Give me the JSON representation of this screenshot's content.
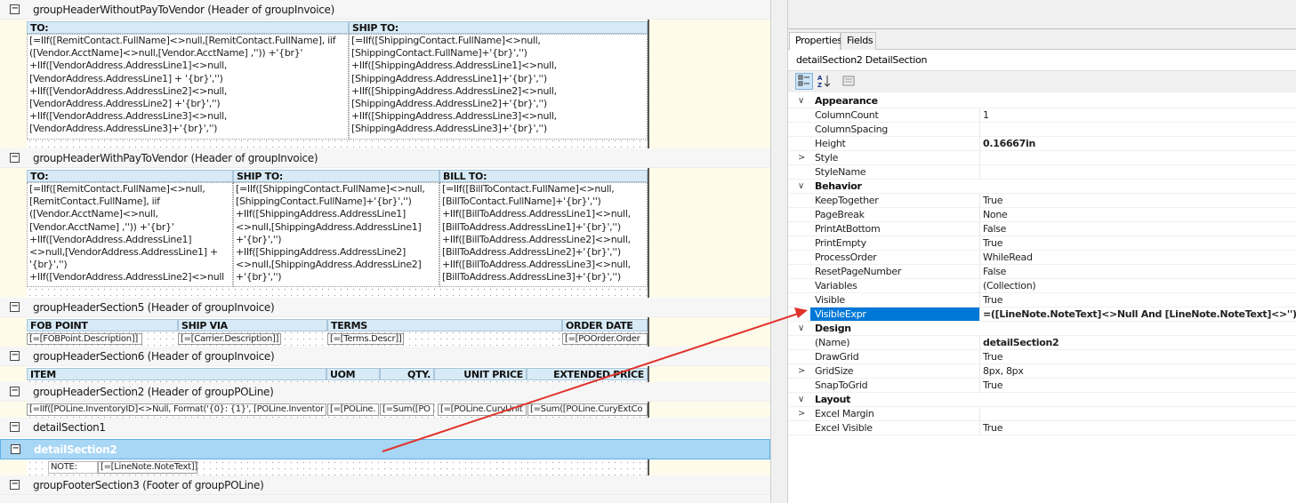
{
  "designer": {
    "bands": [
      {
        "label": "groupHeaderWithoutPayToVendor (Header of groupInvoice)",
        "toggle": "−"
      },
      {
        "label": "groupHeaderWithPayToVendor (Header of groupInvoice)",
        "toggle": "−"
      },
      {
        "label": "groupHeaderSection5 (Header of groupInvoice)",
        "toggle": "−"
      },
      {
        "label": "groupHeaderSection6 (Header of groupInvoice)",
        "toggle": "−"
      },
      {
        "label": "groupHeaderSection2 (Header of groupPOLine)",
        "toggle": "−"
      },
      {
        "label": "detailSection1",
        "toggle": "−"
      },
      {
        "label": "detailSection2",
        "toggle": "−"
      },
      {
        "label": "groupFooterSection3 (Footer of groupPOLine)",
        "toggle": "−"
      }
    ],
    "s1": {
      "to_header": "TO:",
      "shipto_header": "SHIP TO:",
      "to_text": "[=IIf([RemitContact.FullName]<>null,[RemitContact.FullName], iif\n([Vendor.AcctName]<>null,[Vendor.AcctName] ,'')) +'{br}'\n+IIf([VendorAddress.AddressLine1]<>null,\n[VendorAddress.AddressLine1] + '{br}','')\n+IIf([VendorAddress.AddressLine2]<>null,\n[VendorAddress.AddressLine2] +'{br}','')\n+IIf([VendorAddress.AddressLine3]<>null,\n[VendorAddress.AddressLine3]+'{br}','')",
      "shipto_text": "[=IIf([ShippingContact.FullName]<>null,\n[ShippingContact.FullName]+'{br}','')\n+IIf([ShippingAddress.AddressLine1]<>null,\n[ShippingAddress.AddressLine1]+'{br}','')\n+IIf([ShippingAddress.AddressLine2]<>null,\n[ShippingAddress.AddressLine2]+'{br}','')\n+IIf([ShippingAddress.AddressLine3]<>null,\n[ShippingAddress.AddressLine3]+'{br}','')"
    },
    "s2": {
      "to_header": "TO:",
      "shipto_header": "SHIP TO:",
      "billto_header": "BILL TO:",
      "to_text": "[=IIf([RemitContact.FullName]<>null,\n[RemitContact.FullName], iif\n([Vendor.AcctName]<>null,\n[Vendor.AcctName] ,'')) +'{br}'\n+IIf([VendorAddress.AddressLine1]\n<>null,[VendorAddress.AddressLine1] +\n'{br}','')\n+IIf([VendorAddress.AddressLine2]<>null",
      "shipto_text": "[=IIf([ShippingContact.FullName]<>null,\n[ShippingContact.FullName]+'{br}','')\n+IIf([ShippingAddress.AddressLine1]\n<>null,[ShippingAddress.AddressLine1]\n+'{br}','')\n+IIf([ShippingAddress.AddressLine2]\n<>null,[ShippingAddress.AddressLine2]\n+'{br}','')",
      "billto_text": "[=IIf([BillToContact.FullName]<>null,\n[BillToContact.FullName]+'{br}','')\n+IIf([BillToAddress.AddressLine1]<>null,\n[BillToAddress.AddressLine1]+'{br}','')\n+IIf([BillToAddress.AddressLine2]<>null,\n[BillToAddress.AddressLine2]+'{br}','')\n+IIf([BillToAddress.AddressLine3]<>null,\n[BillToAddress.AddressLine3]+'{br}','')"
    },
    "s3": {
      "headers": [
        "FOB POINT",
        "SHIP VIA",
        "TERMS",
        "ORDER DATE"
      ],
      "fields": [
        "[=[FOBPoint.Description]]",
        "[=[Carrier.Description]]",
        "[=[Terms.Descr]]",
        "[=[POOrder.Order"
      ]
    },
    "s4": {
      "headers": [
        "ITEM",
        "UOM",
        "QTY.",
        "UNIT PRICE",
        "EXTENDED PRICE"
      ]
    },
    "s5": {
      "fields": [
        "[=IIf([POLine.InventoryID]<>Null, Format('{0}: {1}', [POLine.Inventor",
        "[=[POLine.",
        "[=Sum([PO",
        "[=[POLine.CuryUnit",
        "[=Sum([POLine.CuryExtCo"
      ]
    },
    "detail2": {
      "note_label": "NOTE:",
      "note_field": "[=[LineNote.NoteText]]"
    }
  },
  "panel": {
    "tabs": [
      "Properties",
      "Fields"
    ],
    "object_selector": "detailSection2  DetailSection",
    "toolbar": [
      "categorized-icon",
      "alphabetical-icon",
      "property-pages-icon"
    ],
    "rows": [
      {
        "type": "cat",
        "name": "Appearance",
        "chevron": "∨"
      },
      {
        "type": "prop",
        "name": "ColumnCount",
        "value": "1"
      },
      {
        "type": "prop",
        "name": "ColumnSpacing",
        "value": ""
      },
      {
        "type": "prop",
        "name": "Height",
        "value": "0.16667in",
        "bold": true
      },
      {
        "type": "prop",
        "name": "Style",
        "value": "",
        "chevron": ">"
      },
      {
        "type": "prop",
        "name": "StyleName",
        "value": ""
      },
      {
        "type": "cat",
        "name": "Behavior",
        "chevron": "∨"
      },
      {
        "type": "prop",
        "name": "KeepTogether",
        "value": "True"
      },
      {
        "type": "prop",
        "name": "PageBreak",
        "value": "None"
      },
      {
        "type": "prop",
        "name": "PrintAtBottom",
        "value": "False"
      },
      {
        "type": "prop",
        "name": "PrintEmpty",
        "value": "True"
      },
      {
        "type": "prop",
        "name": "ProcessOrder",
        "value": "WhileRead"
      },
      {
        "type": "prop",
        "name": "ResetPageNumber",
        "value": "False"
      },
      {
        "type": "prop",
        "name": "Variables",
        "value": "(Collection)"
      },
      {
        "type": "prop",
        "name": "Visible",
        "value": "True"
      },
      {
        "type": "prop",
        "name": "VisibleExpr",
        "value": "=([LineNote.NoteText]<>Null And [LineNote.NoteText]<>'')",
        "bold": true,
        "selected": true
      },
      {
        "type": "cat",
        "name": "Design",
        "chevron": "∨"
      },
      {
        "type": "prop",
        "name": "(Name)",
        "value": "detailSection2",
        "bold": true
      },
      {
        "type": "prop",
        "name": "DrawGrid",
        "value": "True"
      },
      {
        "type": "prop",
        "name": "GridSize",
        "value": "8px, 8px",
        "chevron": ">"
      },
      {
        "type": "prop",
        "name": "SnapToGrid",
        "value": "True"
      },
      {
        "type": "cat",
        "name": "Layout",
        "chevron": "∨"
      },
      {
        "type": "prop",
        "name": "Excel Margin",
        "value": "",
        "chevron": ">"
      },
      {
        "type": "prop",
        "name": "Excel Visible",
        "value": "True"
      }
    ]
  },
  "colors": {
    "arrow": "#e0332c",
    "selection": "#0078d7",
    "band_selected": "#a8d6f5"
  }
}
